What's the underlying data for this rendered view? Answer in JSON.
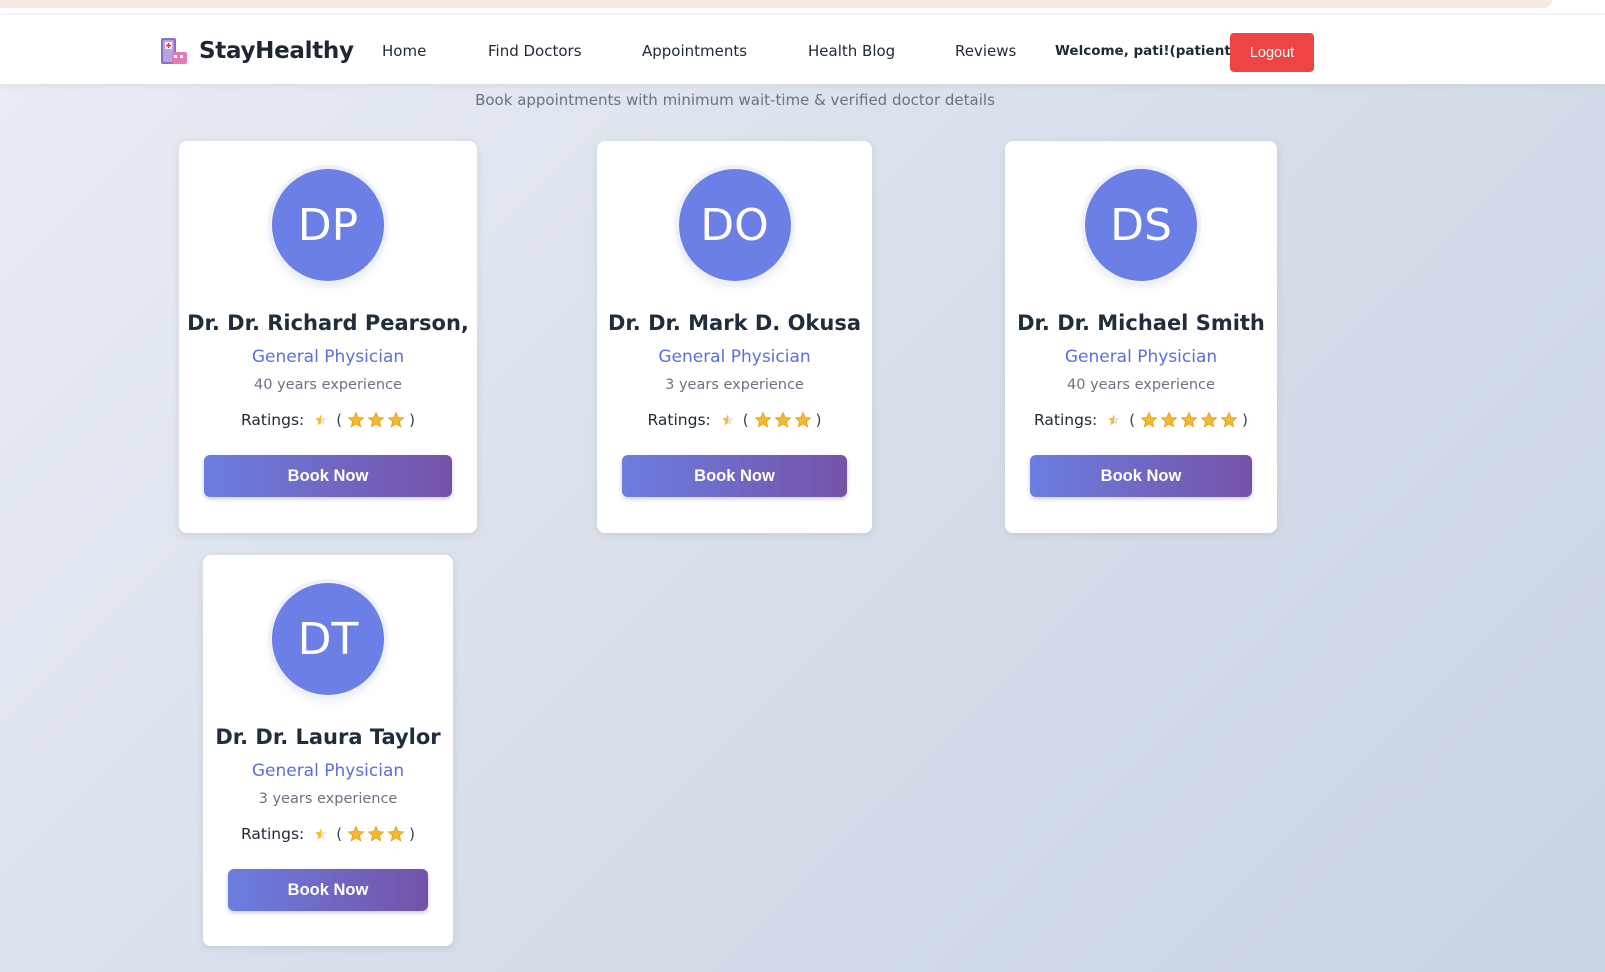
{
  "brand": {
    "name": "StayHealthy",
    "logo_icon": "hospital-icon"
  },
  "nav": {
    "home": "Home",
    "find_doctors": "Find Doctors",
    "appointments": "Appointments",
    "health_blog": "Health Blog",
    "reviews": "Reviews",
    "welcome": "Welcome, pati!(patient)",
    "logout": "Logout"
  },
  "subtitle": "Book appointments with minimum wait-time & verified doctor details",
  "ratings_label": "Ratings:",
  "doctors": [
    {
      "initials": "DP",
      "name": "Dr. Dr. Richard Pearson,",
      "specialty": "General Physician",
      "experience": "40 years experience",
      "stars": 3,
      "book_label": "Book Now"
    },
    {
      "initials": "DO",
      "name": "Dr. Dr. Mark D. Okusa",
      "specialty": "General Physician",
      "experience": "3 years experience",
      "stars": 3,
      "book_label": "Book Now"
    },
    {
      "initials": "DS",
      "name": "Dr. Dr. Michael Smith",
      "specialty": "General Physician",
      "experience": "40 years experience",
      "stars": 5,
      "book_label": "Book Now"
    },
    {
      "initials": "DT",
      "name": "Dr. Dr. Laura Taylor",
      "specialty": "General Physician",
      "experience": "3 years experience",
      "stars": 3,
      "book_label": "Book Now"
    }
  ],
  "colors": {
    "accent": "#6b7fe6",
    "logout": "#ef4444",
    "star": "#f5b82e"
  }
}
